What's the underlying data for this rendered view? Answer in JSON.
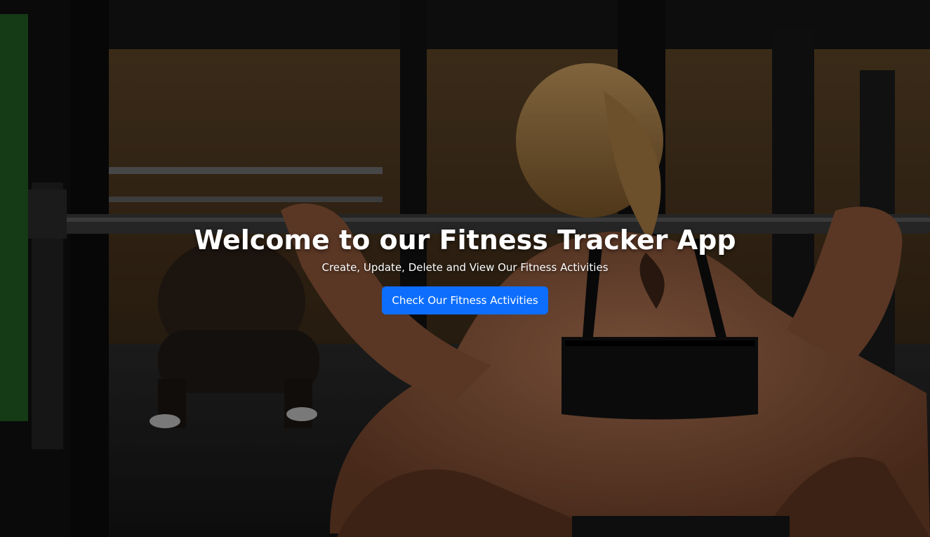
{
  "hero": {
    "title": "Welcome to our Fitness Tracker App",
    "subtitle": "Create, Update, Delete and View Our Fitness Activities",
    "cta_label": "Check Our Fitness Activities"
  },
  "colors": {
    "primary": "#0d6efd",
    "text": "#ffffff"
  }
}
